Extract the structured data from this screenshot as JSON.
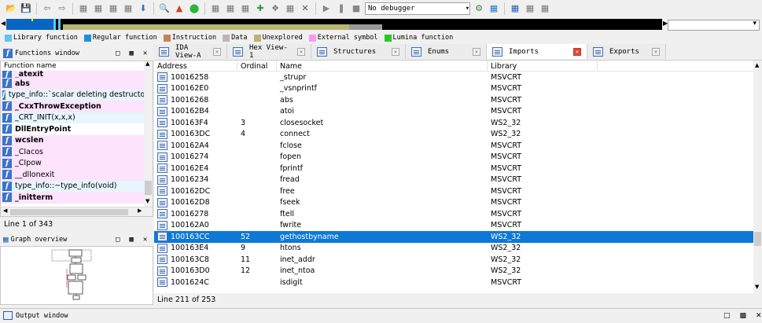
{
  "toolbar": {
    "debugger_select": "No debugger"
  },
  "legend": [
    {
      "label": "Library function",
      "color": "#5ec6ef"
    },
    {
      "label": "Regular function",
      "color": "#1e90d8"
    },
    {
      "label": "Instruction",
      "color": "#c88058"
    },
    {
      "label": "Data",
      "color": "#b8b8b8"
    },
    {
      "label": "Unexplored",
      "color": "#b8b474"
    },
    {
      "label": "External symbol",
      "color": "#ff96f0"
    },
    {
      "label": "Lumina function",
      "color": "#28c828"
    }
  ],
  "functions_window": {
    "title": "Functions window",
    "column": "Function name",
    "rows": [
      {
        "name": "_atexit",
        "style": "pink bold"
      },
      {
        "name": "abs",
        "style": "pink bold"
      },
      {
        "name": "type_info::`scalar deleting destructor'(ui",
        "style": "lib"
      },
      {
        "name": "_CxxThrowException",
        "style": "pink bold"
      },
      {
        "name": "_CRT_INIT(x,x,x)",
        "style": "lib"
      },
      {
        "name": "DllEntryPoint",
        "style": "bold"
      },
      {
        "name": "wcslen",
        "style": "pink bold"
      },
      {
        "name": "_CIacos",
        "style": "pink"
      },
      {
        "name": "_CIpow",
        "style": "pink"
      },
      {
        "name": "__dllonexit",
        "style": "pink"
      },
      {
        "name": "type_info::~type_info(void)",
        "style": "lib"
      },
      {
        "name": "_initterm",
        "style": "pink bold"
      }
    ],
    "status": "Line 1 of 343"
  },
  "graph_overview": {
    "title": "Graph overview"
  },
  "tabs": [
    {
      "label": "IDA View-A",
      "active": false
    },
    {
      "label": "Hex View-1",
      "active": false
    },
    {
      "label": "Structures",
      "active": false
    },
    {
      "label": "Enums",
      "active": false
    },
    {
      "label": "Imports",
      "active": true
    },
    {
      "label": "Exports",
      "active": false
    }
  ],
  "imports": {
    "columns": {
      "address": "Address",
      "ordinal": "Ordinal",
      "name": "Name",
      "library": "Library"
    },
    "rows": [
      {
        "address": "10016258",
        "ordinal": "",
        "name": "_strupr",
        "library": "MSVCRT"
      },
      {
        "address": "100162E0",
        "ordinal": "",
        "name": "_vsnprintf",
        "library": "MSVCRT"
      },
      {
        "address": "10016268",
        "ordinal": "",
        "name": "abs",
        "library": "MSVCRT"
      },
      {
        "address": "100162B4",
        "ordinal": "",
        "name": "atoi",
        "library": "MSVCRT"
      },
      {
        "address": "100163F4",
        "ordinal": "3",
        "name": "closesocket",
        "library": "WS2_32"
      },
      {
        "address": "100163DC",
        "ordinal": "4",
        "name": "connect",
        "library": "WS2_32"
      },
      {
        "address": "100162A4",
        "ordinal": "",
        "name": "fclose",
        "library": "MSVCRT"
      },
      {
        "address": "10016274",
        "ordinal": "",
        "name": "fopen",
        "library": "MSVCRT"
      },
      {
        "address": "100162E4",
        "ordinal": "",
        "name": "fprintf",
        "library": "MSVCRT"
      },
      {
        "address": "10016234",
        "ordinal": "",
        "name": "fread",
        "library": "MSVCRT"
      },
      {
        "address": "100162DC",
        "ordinal": "",
        "name": "free",
        "library": "MSVCRT"
      },
      {
        "address": "100162D8",
        "ordinal": "",
        "name": "fseek",
        "library": "MSVCRT"
      },
      {
        "address": "10016278",
        "ordinal": "",
        "name": "ftell",
        "library": "MSVCRT"
      },
      {
        "address": "100162A0",
        "ordinal": "",
        "name": "fwrite",
        "library": "MSVCRT"
      },
      {
        "address": "100163CC",
        "ordinal": "52",
        "name": "gethostbyname",
        "library": "WS2_32",
        "selected": true
      },
      {
        "address": "100163E4",
        "ordinal": "9",
        "name": "htons",
        "library": "WS2_32"
      },
      {
        "address": "100163C8",
        "ordinal": "11",
        "name": "inet_addr",
        "library": "WS2_32"
      },
      {
        "address": "100163D0",
        "ordinal": "12",
        "name": "inet_ntoa",
        "library": "WS2_32"
      },
      {
        "address": "1001624C",
        "ordinal": "",
        "name": "isdigit",
        "library": "MSVCRT"
      }
    ],
    "status": "Line 211 of 253"
  },
  "output_window": {
    "title": "Output window"
  }
}
